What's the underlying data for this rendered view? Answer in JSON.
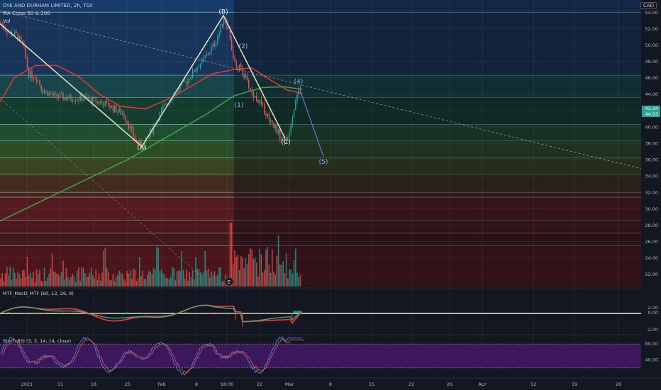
{
  "header": {
    "symbol_line": "DYE AND DURHAM LIMITED, 2h, TSX",
    "indicator_line": "MA Cross 50 & 200",
    "vol_line": "Vol",
    "currency": "CAD"
  },
  "chart_data": [
    {
      "type": "candlestick",
      "x_ticks": [
        "2021",
        "11",
        "18",
        "25",
        "Feb",
        "8",
        "18:00",
        "22",
        "Mar",
        "8",
        "15",
        "22",
        "26",
        "Apr",
        "12",
        "19",
        "26"
      ],
      "y_ticks": [
        54.0,
        52.0,
        50.0,
        48.0,
        46.0,
        44.0,
        42.0,
        40.0,
        38.0,
        36.0,
        34.0,
        32.0,
        30.0,
        28.0,
        26.0,
        24.0,
        22.0
      ],
      "ylim": [
        20.5,
        55.5
      ],
      "price_labels": [
        "43.34",
        "44.03"
      ],
      "price_path": [
        [
          0,
          52.8
        ],
        [
          12,
          51.5
        ],
        [
          24,
          51.2
        ],
        [
          34,
          49.5
        ],
        [
          40,
          46.5
        ],
        [
          52,
          46
        ],
        [
          60,
          44.5
        ],
        [
          75,
          43.8
        ],
        [
          95,
          43.5
        ],
        [
          120,
          43.5
        ],
        [
          150,
          42.8
        ],
        [
          175,
          41.5
        ],
        [
          190,
          38.5
        ],
        [
          200,
          37.5
        ],
        [
          210,
          39
        ],
        [
          222,
          41
        ],
        [
          235,
          43
        ],
        [
          250,
          44.5
        ],
        [
          262,
          45.5
        ],
        [
          275,
          47
        ],
        [
          290,
          48.5
        ],
        [
          305,
          50.5
        ],
        [
          316,
          53.5
        ],
        [
          322,
          52
        ],
        [
          328,
          49
        ],
        [
          333,
          47
        ],
        [
          340,
          47.3
        ],
        [
          348,
          45.5
        ],
        [
          356,
          44
        ],
        [
          366,
          43
        ],
        [
          376,
          41.5
        ],
        [
          388,
          40
        ],
        [
          398,
          38.5
        ],
        [
          405,
          38.3
        ],
        [
          410,
          40.5
        ],
        [
          416,
          43
        ],
        [
          422,
          44.5
        ],
        [
          426,
          44
        ]
      ],
      "ma50_path": [
        [
          0,
          43
        ],
        [
          20,
          46
        ],
        [
          50,
          47.5
        ],
        [
          80,
          47.5
        ],
        [
          110,
          46.2
        ],
        [
          140,
          44
        ],
        [
          170,
          42.5
        ],
        [
          205,
          42.2
        ],
        [
          240,
          43.5
        ],
        [
          270,
          45
        ],
        [
          300,
          46.5
        ],
        [
          330,
          47
        ],
        [
          355,
          47.2
        ],
        [
          380,
          45.8
        ],
        [
          405,
          44.5
        ],
        [
          426,
          44.1
        ]
      ],
      "ma200_path": [
        [
          0,
          28.5
        ],
        [
          60,
          31
        ],
        [
          120,
          33.5
        ],
        [
          180,
          36
        ],
        [
          240,
          39
        ],
        [
          290,
          41.5
        ],
        [
          330,
          43.8
        ],
        [
          370,
          44.8
        ],
        [
          400,
          44.9
        ],
        [
          426,
          44.6
        ]
      ],
      "fib_levels": [
        54.0,
        46.3,
        43.6,
        40.3,
        38.3,
        36.2,
        34.2,
        32.0,
        31.4,
        28.6,
        27.0,
        25.5
      ],
      "wave_labels": [
        {
          "text": "(B)",
          "x": 315,
          "y": 53.8
        },
        {
          "text": "(A)",
          "x": 200,
          "y": 37.2
        },
        {
          "text": "(2)",
          "x": 343,
          "y": 49.6
        },
        {
          "text": "(1)",
          "x": 337,
          "y": 42.4
        },
        {
          "text": "(C)",
          "x": 403,
          "y": 37.9
        },
        {
          "text": "(4)",
          "x": 421,
          "y": 45.3
        },
        {
          "text": "(5)",
          "x": 456,
          "y": 35.5
        }
      ],
      "abc_path": [
        [
          0,
          52.6
        ],
        [
          200,
          37.6
        ],
        [
          315,
          53.6
        ],
        [
          402,
          38.6
        ]
      ],
      "projection_path": [
        [
          423,
          44.5
        ],
        [
          456,
          36.4
        ]
      ],
      "trendline": {
        "from": [
          0,
          54.2
        ],
        "to": [
          932,
          34.3
        ]
      },
      "event_marker": "E"
    },
    {
      "type": "line",
      "title": "MTF_MacD_MTF (60, 12, 26, 9)",
      "y_ticks": [
        "2.00",
        "0.00",
        "-2.00"
      ],
      "ylim": [
        -3,
        3
      ]
    },
    {
      "type": "line",
      "title": "Stoch RSI (3, 3, 14, 14, close)",
      "y_ticks": [
        "80.00",
        "40.00"
      ],
      "ylim": [
        0,
        100
      ],
      "band": [
        20,
        80
      ]
    }
  ],
  "colors": {
    "bg": "#131722",
    "up": "#26a69a",
    "down": "#ef5350",
    "ma50": "#e53935",
    "ma200": "#43a047",
    "wave": "#e8e3c0",
    "label": "#7fb7e8",
    "zero_line": "#f3f0d0",
    "stoch_k": "#3f7fd8",
    "stoch_d": "#d84848",
    "stoch_band": "#4a1870"
  }
}
